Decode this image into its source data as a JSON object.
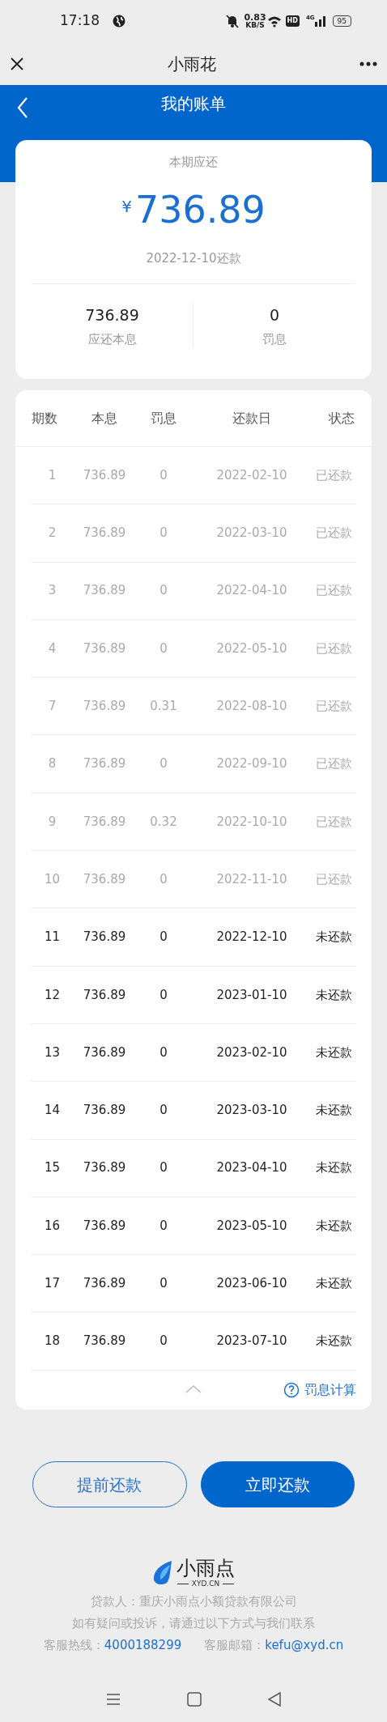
{
  "status_bar": {
    "time": "17:18",
    "speed": "0.83",
    "speed_unit": "KB/S",
    "hd": "HD",
    "network": "4G",
    "battery": "95"
  },
  "title_bar": {
    "title": "小雨花"
  },
  "header": {
    "title": "我的账单"
  },
  "summary": {
    "label": "本期应还",
    "currency": "¥",
    "amount": "736.89",
    "due": "2022-12-10还款",
    "figures": [
      {
        "value": "736.89",
        "label": "应还本息"
      },
      {
        "value": "0",
        "label": "罚息"
      }
    ]
  },
  "table": {
    "columns": [
      "期数",
      "本息",
      "罚息",
      "还款日",
      "状态"
    ],
    "rows": [
      {
        "cells": [
          "1",
          "736.89",
          "0",
          "2022-02-10",
          "已还款"
        ],
        "paid": true
      },
      {
        "cells": [
          "2",
          "736.89",
          "0",
          "2022-03-10",
          "已还款"
        ],
        "paid": true
      },
      {
        "cells": [
          "3",
          "736.89",
          "0",
          "2022-04-10",
          "已还款"
        ],
        "paid": true
      },
      {
        "cells": [
          "4",
          "736.89",
          "0",
          "2022-05-10",
          "已还款"
        ],
        "paid": true
      },
      {
        "cells": [
          "7",
          "736.89",
          "0.31",
          "2022-08-10",
          "已还款"
        ],
        "paid": true
      },
      {
        "cells": [
          "8",
          "736.89",
          "0",
          "2022-09-10",
          "已还款"
        ],
        "paid": true
      },
      {
        "cells": [
          "9",
          "736.89",
          "0.32",
          "2022-10-10",
          "已还款"
        ],
        "paid": true
      },
      {
        "cells": [
          "10",
          "736.89",
          "0",
          "2022-11-10",
          "已还款"
        ],
        "paid": true
      },
      {
        "cells": [
          "11",
          "736.89",
          "0",
          "2022-12-10",
          "未还款"
        ],
        "paid": false
      },
      {
        "cells": [
          "12",
          "736.89",
          "0",
          "2023-01-10",
          "未还款"
        ],
        "paid": false
      },
      {
        "cells": [
          "13",
          "736.89",
          "0",
          "2023-02-10",
          "未还款"
        ],
        "paid": false
      },
      {
        "cells": [
          "14",
          "736.89",
          "0",
          "2023-03-10",
          "未还款"
        ],
        "paid": false
      },
      {
        "cells": [
          "15",
          "736.89",
          "0",
          "2023-04-10",
          "未还款"
        ],
        "paid": false
      },
      {
        "cells": [
          "16",
          "736.89",
          "0",
          "2023-05-10",
          "未还款"
        ],
        "paid": false
      },
      {
        "cells": [
          "17",
          "736.89",
          "0",
          "2023-06-10",
          "未还款"
        ],
        "paid": false
      },
      {
        "cells": [
          "18",
          "736.89",
          "0",
          "2023-07-10",
          "未还款"
        ],
        "paid": false
      }
    ],
    "penalty_link": "罚息计算"
  },
  "buttons": [
    {
      "label": "提前还款",
      "kind": "outline"
    },
    {
      "label": "立即还款",
      "kind": "solid"
    }
  ],
  "footer": {
    "logo_name": "小雨点",
    "logo_domain": "XYD.CN",
    "lender": "贷款人：重庆小雨点小额贷款有限公司",
    "contact_note": "如有疑问或投诉，请通过以下方式与我们联系",
    "hotline_label": "客服热线：",
    "hotline": "4000188299",
    "email_label": "客服邮箱：",
    "email": "kefu@xyd.cn"
  }
}
